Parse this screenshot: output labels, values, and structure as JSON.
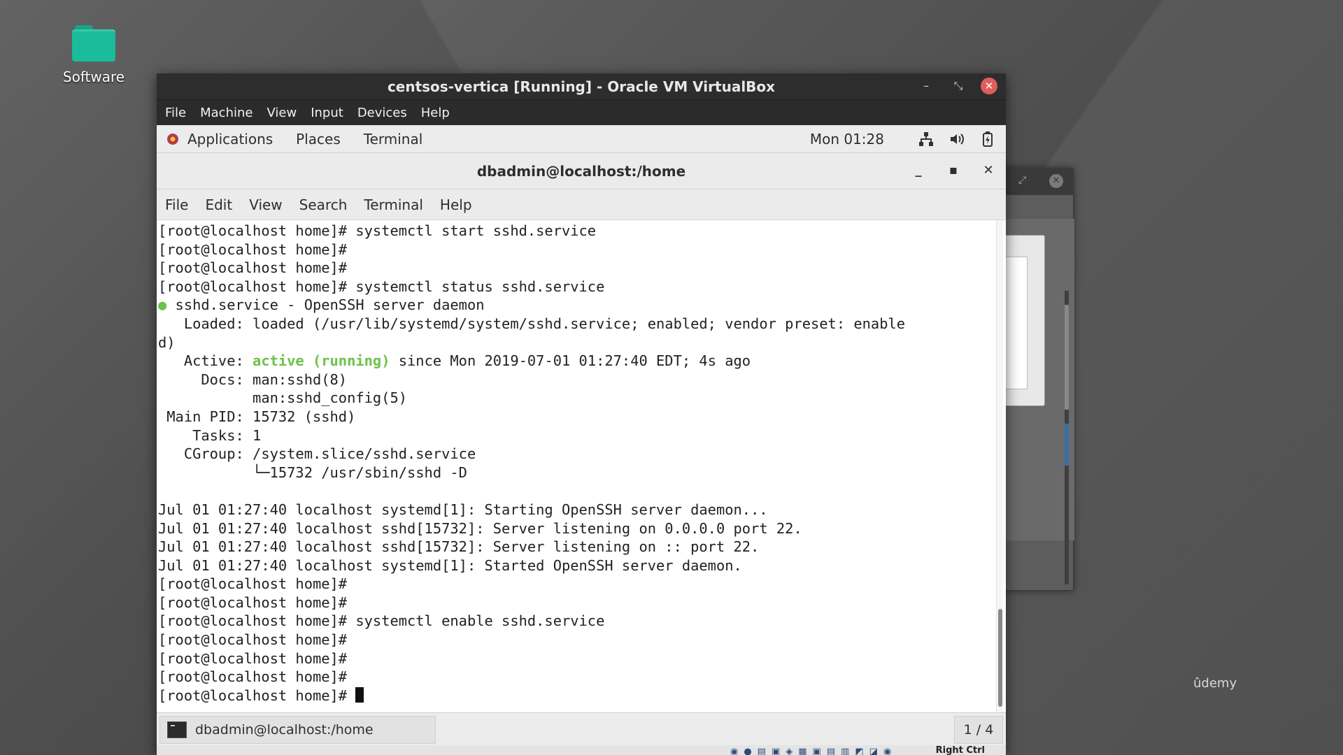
{
  "desktop": {
    "icon_label": "Software",
    "watermark": "ûdemy"
  },
  "vbox": {
    "title": "centsos-vertica [Running] - Oracle VM VirtualBox",
    "menu": [
      "File",
      "Machine",
      "View",
      "Input",
      "Devices",
      "Help"
    ],
    "status_host_key": "Right Ctrl"
  },
  "gnome_panel": {
    "applications": "Applications",
    "places": "Places",
    "terminal": "Terminal",
    "clock": "Mon 01:28"
  },
  "terminal": {
    "title": "dbadmin@localhost:/home",
    "menu": [
      "File",
      "Edit",
      "View",
      "Search",
      "Terminal",
      "Help"
    ],
    "lines": [
      "[root@localhost home]# systemctl start sshd.service",
      "[root@localhost home]#",
      "[root@localhost home]#",
      "[root@localhost home]# systemctl status sshd.service",
      "",
      "   Loaded: loaded (/usr/lib/systemd/system/sshd.service; enabled; vendor preset: enable",
      "d)",
      "",
      "     Docs: man:sshd(8)",
      "           man:sshd_config(5)",
      " Main PID: 15732 (sshd)",
      "    Tasks: 1",
      "   CGroup: /system.slice/sshd.service",
      "           └─15732 /usr/sbin/sshd -D",
      "",
      "Jul 01 01:27:40 localhost systemd[1]: Starting OpenSSH server daemon...",
      "Jul 01 01:27:40 localhost sshd[15732]: Server listening on 0.0.0.0 port 22.",
      "Jul 01 01:27:40 localhost sshd[15732]: Server listening on :: port 22.",
      "Jul 01 01:27:40 localhost systemd[1]: Started OpenSSH server daemon.",
      "[root@localhost home]#",
      "[root@localhost home]#",
      "[root@localhost home]# systemctl enable sshd.service",
      "[root@localhost home]#",
      "[root@localhost home]#",
      "[root@localhost home]#",
      "[root@localhost home]# "
    ],
    "service_dot": "●",
    "service_line": " sshd.service - OpenSSH server daemon",
    "active_prefix": "   Active: ",
    "active_state": "active (running)",
    "active_suffix": " since Mon 2019-07-01 01:27:40 EDT; 4s ago"
  },
  "taskbar": {
    "task_label": "dbadmin@localhost:/home",
    "pager": "1 / 4"
  }
}
